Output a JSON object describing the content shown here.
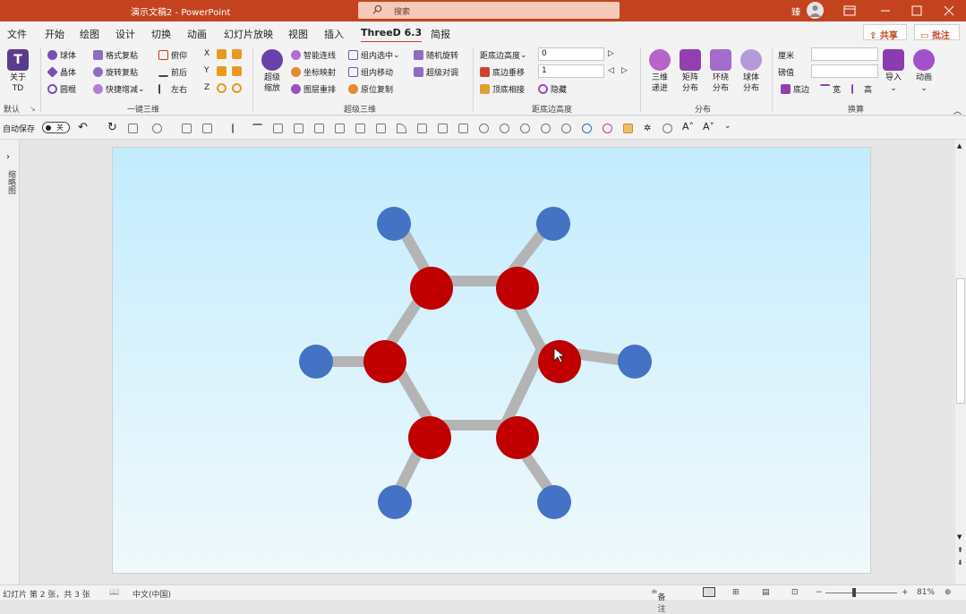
{
  "titlebar": {
    "title": "演示文稿2 - PowerPoint",
    "search_placeholder": "搜索",
    "user_name": "臻"
  },
  "menu": {
    "tabs": [
      "文件",
      "开始",
      "绘图",
      "设计",
      "切换",
      "动画",
      "幻灯片放映",
      "视图",
      "插入",
      "ThreeD 6.3",
      "简报"
    ],
    "active_tab": "ThreeD 6.3",
    "share_label": "共享",
    "comment_label": "批注"
  },
  "ribbon": {
    "about_label": "关于TD",
    "about_lines": [
      "关于",
      "TD"
    ],
    "default_label": "默认",
    "group1": {
      "label": "一键三维",
      "items": [
        "球体",
        "晶体",
        "圆棍",
        "格式复粘",
        "旋转复粘",
        "快捷增减",
        "俯仰",
        "前后",
        "左右"
      ],
      "axes": [
        "X",
        "Y",
        "Z"
      ]
    },
    "group2": {
      "label": "超级三维",
      "big_label": [
        "超级",
        "缩放"
      ],
      "items": [
        "智能连线",
        "坐标映射",
        "图层重排",
        "组内选中",
        "组内移动",
        "原位复制",
        "随机旋转",
        "超级对调"
      ]
    },
    "group3": {
      "label": "距底边高度",
      "items": [
        "距底边高度",
        "底边垂移",
        "顶底相接",
        "隐藏"
      ],
      "value1": "0",
      "value2": "1"
    },
    "group4": {
      "label": "分布",
      "items": [
        [
          "三维",
          "递进"
        ],
        [
          "矩阵",
          "分布"
        ],
        [
          "环绕",
          "分布"
        ],
        [
          "球体",
          "分布"
        ]
      ]
    },
    "group5": {
      "label": "换算",
      "items": [
        "厘米",
        "磅值",
        "底边",
        "宽",
        "高"
      ],
      "import_label": "导入",
      "anim_label": "动画"
    }
  },
  "toolbar2": {
    "autosave_label": "自动保存",
    "autosave_state": "关"
  },
  "left_panel": {
    "label": "缩略图"
  },
  "status": {
    "slide_info": "幻灯片 第 2 张，共 3 张",
    "language": "中文(中国)",
    "notes_label": "备注",
    "zoom": "81%"
  },
  "molecule": {
    "ring_color": "#c00000",
    "h_color": "#4472c4",
    "bond_color": "#b4b4b4",
    "ring_atoms": 6,
    "h_atoms": 6
  }
}
